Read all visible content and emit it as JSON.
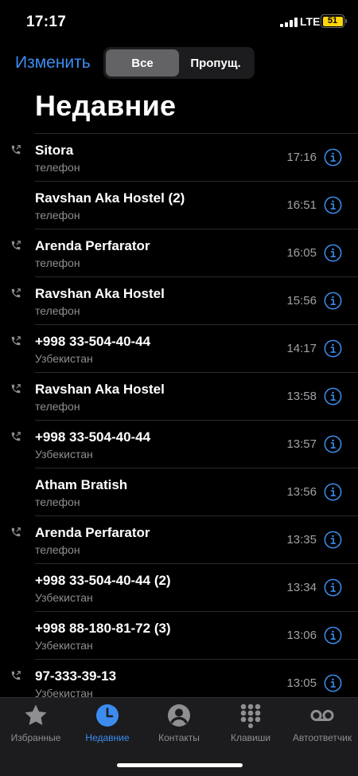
{
  "status": {
    "time": "17:17",
    "network": "LTE",
    "battery": "51"
  },
  "nav": {
    "edit_label": "Изменить",
    "segments": [
      "Все",
      "Пропущ."
    ],
    "selected_segment": "Все"
  },
  "title": "Недавние",
  "calls": [
    {
      "name": "Sitora",
      "sub": "телефон",
      "time": "17:16",
      "outgoing": true
    },
    {
      "name": "Ravshan Aka Hostel (2)",
      "sub": "телефон",
      "time": "16:51",
      "outgoing": false
    },
    {
      "name": "Arenda Perfarator",
      "sub": "телефон",
      "time": "16:05",
      "outgoing": true
    },
    {
      "name": "Ravshan Aka Hostel",
      "sub": "телефон",
      "time": "15:56",
      "outgoing": true
    },
    {
      "name": "+998 33-504-40-44",
      "sub": "Узбекистан",
      "time": "14:17",
      "outgoing": true
    },
    {
      "name": "Ravshan Aka Hostel",
      "sub": "телефон",
      "time": "13:58",
      "outgoing": true
    },
    {
      "name": "+998 33-504-40-44",
      "sub": "Узбекистан",
      "time": "13:57",
      "outgoing": true
    },
    {
      "name": "Atham Bratish",
      "sub": "телефон",
      "time": "13:56",
      "outgoing": false
    },
    {
      "name": "Arenda Perfarator",
      "sub": "телефон",
      "time": "13:35",
      "outgoing": true
    },
    {
      "name": "+998 33-504-40-44 (2)",
      "sub": "Узбекистан",
      "time": "13:34",
      "outgoing": false
    },
    {
      "name": "+998 88-180-81-72 (3)",
      "sub": "Узбекистан",
      "time": "13:06",
      "outgoing": false
    },
    {
      "name": "97-333-39-13",
      "sub": "Узбекистан",
      "time": "13:05",
      "outgoing": true
    }
  ],
  "tabs": [
    {
      "label": "Избранные",
      "icon": "star-icon"
    },
    {
      "label": "Недавние",
      "icon": "clock-icon",
      "active": true
    },
    {
      "label": "Контакты",
      "icon": "person-circle-icon"
    },
    {
      "label": "Клавиши",
      "icon": "keypad-icon"
    },
    {
      "label": "Автоответчик",
      "icon": "voicemail-icon"
    }
  ],
  "colors": {
    "accent": "#3c8cf0",
    "background": "#000000",
    "secondary_text": "#8e8e93",
    "battery": "#ffd60a"
  }
}
